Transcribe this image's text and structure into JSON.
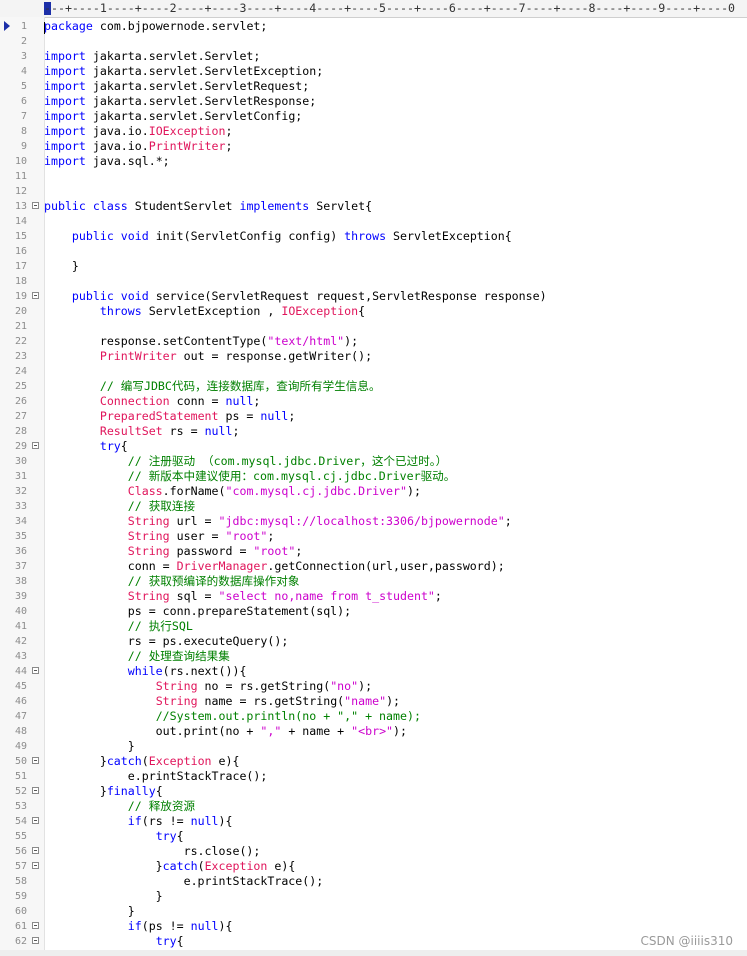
{
  "ruler": {
    "text": "---+----1----+----2----+----3----+----4----+----5----+----6----+----7----+----8----+----9----+----0"
  },
  "watermark": "CSDN @iiiis310",
  "colors": {
    "keyword": "#0000ff",
    "type": "#e0155b",
    "string": "#cc00cc",
    "comment": "#008000",
    "marker": "#1c2fa8"
  },
  "icons": {
    "current_line": "arrow-marker-icon",
    "fold": "fold-minus-icon"
  },
  "code": {
    "fold_lines": [
      13,
      19,
      29,
      44,
      50,
      52,
      54,
      56,
      57,
      61,
      62
    ],
    "lines": [
      [
        [
          "kw",
          "package"
        ],
        [
          "",
          "com.bjpowernode.servlet;"
        ]
      ],
      [],
      [
        [
          "kw",
          "import"
        ],
        [
          "",
          "jakarta.servlet.Servlet;"
        ]
      ],
      [
        [
          "kw",
          "import"
        ],
        [
          "",
          "jakarta.servlet.ServletException;"
        ]
      ],
      [
        [
          "kw",
          "import"
        ],
        [
          "",
          "jakarta.servlet.ServletRequest;"
        ]
      ],
      [
        [
          "kw",
          "import"
        ],
        [
          "",
          "jakarta.servlet.ServletResponse;"
        ]
      ],
      [
        [
          "kw",
          "import"
        ],
        [
          "",
          "jakarta.servlet.ServletConfig;"
        ]
      ],
      [
        [
          "kw",
          "import"
        ],
        [
          "",
          "java.io."
        ],
        [
          "ty",
          "IOException"
        ],
        [
          "",
          ";"
        ]
      ],
      [
        [
          "kw",
          "import"
        ],
        [
          "",
          "java.io."
        ],
        [
          "ty",
          "PrintWriter"
        ],
        [
          "",
          ";"
        ]
      ],
      [
        [
          "kw",
          "import"
        ],
        [
          "",
          "java.sql.*;"
        ]
      ],
      [],
      [],
      [
        [
          "kw",
          "public"
        ],
        [
          "",
          " "
        ],
        [
          "kw",
          "class"
        ],
        [
          "",
          " StudentServlet "
        ],
        [
          "kw",
          "implements"
        ],
        [
          "",
          " Servlet{"
        ]
      ],
      [],
      [
        [
          "",
          "    "
        ],
        [
          "kw",
          "public"
        ],
        [
          "",
          " "
        ],
        [
          "kw",
          "void"
        ],
        [
          "",
          " init(ServletConfig config) "
        ],
        [
          "kw",
          "throws"
        ],
        [
          "",
          " ServletException{"
        ]
      ],
      [],
      [
        [
          "",
          "    }"
        ]
      ],
      [],
      [
        [
          "",
          "    "
        ],
        [
          "kw",
          "public"
        ],
        [
          "",
          " "
        ],
        [
          "kw",
          "void"
        ],
        [
          "",
          " service(ServletRequest request,ServletResponse response)"
        ]
      ],
      [
        [
          "",
          "        "
        ],
        [
          "kw",
          "throws"
        ],
        [
          "",
          " ServletException , "
        ],
        [
          "ty",
          "IOException"
        ],
        [
          "",
          "{"
        ]
      ],
      [],
      [
        [
          "",
          "        response.setContentType("
        ],
        [
          "st",
          "\"text/html\""
        ],
        [
          "",
          ");"
        ]
      ],
      [
        [
          "",
          "        "
        ],
        [
          "ty",
          "PrintWriter"
        ],
        [
          "",
          " out = response.getWriter();"
        ]
      ],
      [],
      [
        [
          "",
          "        "
        ],
        [
          "cm",
          "// 编写JDBC代码，连接数据库，查询所有学生信息。"
        ]
      ],
      [
        [
          "",
          "        "
        ],
        [
          "ty",
          "Connection"
        ],
        [
          "",
          " conn = "
        ],
        [
          "kw",
          "null"
        ],
        [
          "",
          ";"
        ]
      ],
      [
        [
          "",
          "        "
        ],
        [
          "ty",
          "PreparedStatement"
        ],
        [
          "",
          " ps = "
        ],
        [
          "kw",
          "null"
        ],
        [
          "",
          ";"
        ]
      ],
      [
        [
          "",
          "        "
        ],
        [
          "ty",
          "ResultSet"
        ],
        [
          "",
          " rs = "
        ],
        [
          "kw",
          "null"
        ],
        [
          "",
          ";"
        ]
      ],
      [
        [
          "",
          "        "
        ],
        [
          "kw",
          "try"
        ],
        [
          "",
          "{"
        ]
      ],
      [
        [
          "",
          "            "
        ],
        [
          "cm",
          "// 注册驱动 （com.mysql.jdbc.Driver，这个已过时。）"
        ]
      ],
      [
        [
          "",
          "            "
        ],
        [
          "cm",
          "// 新版本中建议使用：com.mysql.cj.jdbc.Driver驱动。"
        ]
      ],
      [
        [
          "",
          "            "
        ],
        [
          "ty",
          "Class"
        ],
        [
          "",
          ".forName("
        ],
        [
          "st",
          "\"com.mysql.cj.jdbc.Driver\""
        ],
        [
          "",
          ");"
        ]
      ],
      [
        [
          "",
          "            "
        ],
        [
          "cm",
          "// 获取连接"
        ]
      ],
      [
        [
          "",
          "            "
        ],
        [
          "ty",
          "String"
        ],
        [
          "",
          " url = "
        ],
        [
          "st",
          "\"jdbc:mysql://localhost:3306/bjpowernode\""
        ],
        [
          "",
          ";"
        ]
      ],
      [
        [
          "",
          "            "
        ],
        [
          "ty",
          "String"
        ],
        [
          "",
          " user = "
        ],
        [
          "st",
          "\"root\""
        ],
        [
          "",
          ";"
        ]
      ],
      [
        [
          "",
          "            "
        ],
        [
          "ty",
          "String"
        ],
        [
          "",
          " password = "
        ],
        [
          "st",
          "\"root\""
        ],
        [
          "",
          ";"
        ]
      ],
      [
        [
          "",
          "            conn = "
        ],
        [
          "ty",
          "DriverManager"
        ],
        [
          "",
          ".getConnection(url,user,password);"
        ]
      ],
      [
        [
          "",
          "            "
        ],
        [
          "cm",
          "// 获取预编译的数据库操作对象"
        ]
      ],
      [
        [
          "",
          "            "
        ],
        [
          "ty",
          "String"
        ],
        [
          "",
          " sql = "
        ],
        [
          "st",
          "\"select no,name from t_student\""
        ],
        [
          "",
          ";"
        ]
      ],
      [
        [
          "",
          "            ps = conn.prepareStatement(sql);"
        ]
      ],
      [
        [
          "",
          "            "
        ],
        [
          "cm",
          "// 执行SQL"
        ]
      ],
      [
        [
          "",
          "            rs = ps.executeQuery();"
        ]
      ],
      [
        [
          "",
          "            "
        ],
        [
          "cm",
          "// 处理查询结果集"
        ]
      ],
      [
        [
          "",
          "            "
        ],
        [
          "kw",
          "while"
        ],
        [
          "",
          "(rs.next()){"
        ]
      ],
      [
        [
          "",
          "                "
        ],
        [
          "ty",
          "String"
        ],
        [
          "",
          " no = rs.getString("
        ],
        [
          "st",
          "\"no\""
        ],
        [
          "",
          ");"
        ]
      ],
      [
        [
          "",
          "                "
        ],
        [
          "ty",
          "String"
        ],
        [
          "",
          " name = rs.getString("
        ],
        [
          "st",
          "\"name\""
        ],
        [
          "",
          ");"
        ]
      ],
      [
        [
          "",
          "                "
        ],
        [
          "cm",
          "//System.out.println(no + \",\" + name);"
        ]
      ],
      [
        [
          "",
          "                out.print(no + "
        ],
        [
          "st",
          "\",\""
        ],
        [
          "",
          " + name + "
        ],
        [
          "st",
          "\"<br>\""
        ],
        [
          "",
          ");"
        ]
      ],
      [
        [
          "",
          "            }"
        ]
      ],
      [
        [
          "",
          "        }"
        ],
        [
          "kw",
          "catch"
        ],
        [
          "",
          "("
        ],
        [
          "ty",
          "Exception"
        ],
        [
          "",
          " e){"
        ]
      ],
      [
        [
          "",
          "            e.printStackTrace();"
        ]
      ],
      [
        [
          "",
          "        }"
        ],
        [
          "kw",
          "finally"
        ],
        [
          "",
          "{"
        ]
      ],
      [
        [
          "",
          "            "
        ],
        [
          "cm",
          "// 释放资源"
        ]
      ],
      [
        [
          "",
          "            "
        ],
        [
          "kw",
          "if"
        ],
        [
          "",
          "(rs != "
        ],
        [
          "kw",
          "null"
        ],
        [
          "",
          "){"
        ]
      ],
      [
        [
          "",
          "                "
        ],
        [
          "kw",
          "try"
        ],
        [
          "",
          "{"
        ]
      ],
      [
        [
          "",
          "                    rs.close();"
        ]
      ],
      [
        [
          "",
          "                }"
        ],
        [
          "kw",
          "catch"
        ],
        [
          "",
          "("
        ],
        [
          "ty",
          "Exception"
        ],
        [
          "",
          " e){"
        ]
      ],
      [
        [
          "",
          "                    e.printStackTrace();"
        ]
      ],
      [
        [
          "",
          "                }"
        ]
      ],
      [
        [
          "",
          "            }"
        ]
      ],
      [
        [
          "",
          "            "
        ],
        [
          "kw",
          "if"
        ],
        [
          "",
          "(ps != "
        ],
        [
          "kw",
          "null"
        ],
        [
          "",
          "){"
        ]
      ],
      [
        [
          "",
          "                "
        ],
        [
          "kw",
          "try"
        ],
        [
          "",
          "{"
        ]
      ]
    ]
  }
}
